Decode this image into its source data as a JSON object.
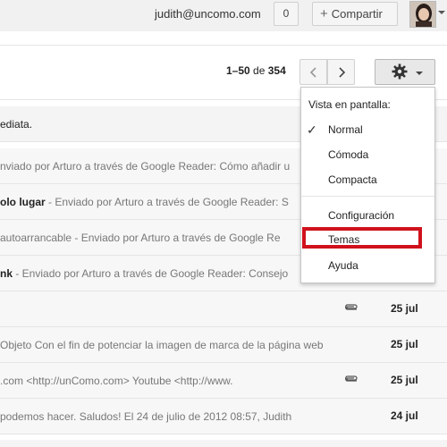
{
  "header": {
    "account_email": "judith@uncomo.com",
    "notification_count": "0",
    "share_label": "Compartir",
    "share_icon": "plus-icon"
  },
  "toolbar": {
    "range_start_end": "1–50",
    "range_of": "de",
    "range_total": "354",
    "prev_icon": "chevron-left-icon",
    "next_icon": "chevron-right-icon",
    "settings_icon": "gear-icon"
  },
  "messages": [
    {
      "text": "ediata.",
      "date": ""
    },
    {
      "sender": "",
      "snippet": "nviado por Arturo a través de Google Reader: Cómo añadir u",
      "date": ""
    },
    {
      "sender": "olo lugar",
      "snippet": " - Enviado por Arturo a través de Google Reader: S",
      "date": ""
    },
    {
      "sender": "",
      "snippet": "autoarrancable - Enviado por Arturo a través de Google Re",
      "date": ""
    },
    {
      "sender": "nk",
      "snippet": " - Enviado por Arturo a través de Google Reader: Consejo",
      "date": ""
    },
    {
      "sender": "",
      "snippet": "",
      "date": "25 jul",
      "attachment": true
    },
    {
      "sender": "",
      "snippet": "Objeto Con el fin de potenciar la imagen de marca de la página web",
      "date": "25 jul"
    },
    {
      "sender": "",
      "snippet": ".com <http://unComo.com> Youtube <http://www.",
      "date": "25 jul",
      "attachment": true
    },
    {
      "sender": "",
      "snippet": "podemos hacer. Saludos! El 24 de julio de 2012 08:57, Judith",
      "date": "24 jul"
    }
  ],
  "settings_menu": {
    "header": "Vista en pantalla:",
    "density_options": [
      "Normal",
      "Cómoda",
      "Compacta"
    ],
    "selected_density": "Normal",
    "actions": [
      "Configuración",
      "Temas",
      "Ayuda"
    ],
    "highlighted_action": "Temas",
    "highlight_color": "#d0121d"
  }
}
